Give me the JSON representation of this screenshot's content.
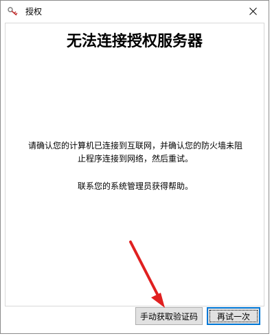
{
  "window": {
    "title": "授权",
    "icon": "key-app-icon"
  },
  "titlebar": {
    "close_icon": "close-icon"
  },
  "main": {
    "headline": "无法连接授权服务器",
    "message_line1": "请确认您的计算机已连接到互联网，并确认您的防火墙未阻",
    "message_line2": "止程序连接到网络，然后重试。",
    "contact": "联系您的系统管理员获得帮助。"
  },
  "buttons": {
    "manual_label": "手动获取验证码",
    "retry_label": "再试一次"
  },
  "annotation": {
    "arrow_color": "#e02020"
  }
}
